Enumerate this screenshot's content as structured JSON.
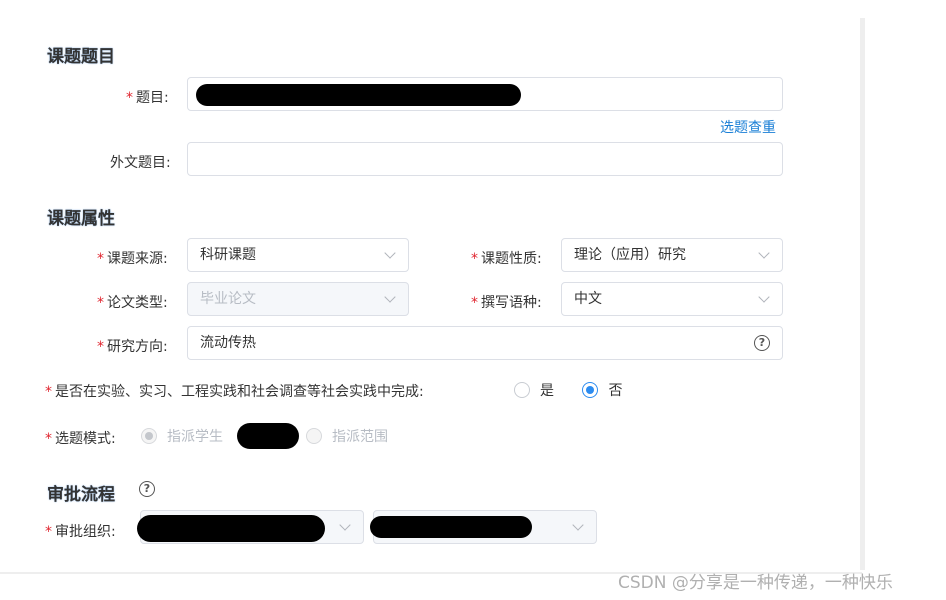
{
  "sections": {
    "topic_title": "课题题目",
    "topic_attr": "课题属性",
    "approval": "审批流程"
  },
  "required_mark": "*",
  "topic": {
    "title_label": "题目:",
    "check_link": "选题查重",
    "foreign_label": "外文题目:",
    "foreign_value": ""
  },
  "attrs": {
    "source_label": "课题来源:",
    "source_value": "科研课题",
    "nature_label": "课题性质:",
    "nature_value": "理论（应用）研究",
    "thesis_type_label": "论文类型:",
    "thesis_type_value": "毕业论文",
    "language_label": "撰写语种:",
    "language_value": "中文",
    "direction_label": "研究方向:",
    "direction_value": "流动传热",
    "practice_label": "是否在实验、实习、工程实践和社会调查等社会实践中完成:",
    "practice_yes": "是",
    "practice_no": "否",
    "practice_selected": "否",
    "mode_label": "选题模式:",
    "mode_assign_student": "指派学生",
    "mode_assign_scope": "指派范围",
    "mode_selected": "指派学生"
  },
  "approval": {
    "org_label": "审批组织:"
  },
  "icons": {
    "help": "question-circle-icon",
    "chevron": "chevron-down-icon"
  },
  "colors": {
    "required": "#e0252f",
    "link": "#1a7fd6",
    "radio_active": "#2d8cf0"
  },
  "watermark": "CSDN @分享是一种传递，一种快乐"
}
